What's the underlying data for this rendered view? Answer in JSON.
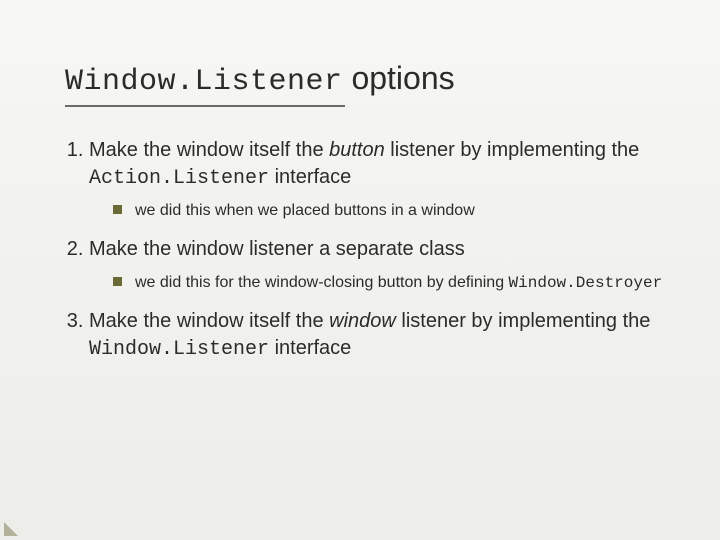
{
  "title": {
    "code": "Window.Listener",
    "rest": " options"
  },
  "items": [
    {
      "pre": " Make the window itself the ",
      "em": "button",
      "mid": " listener by implementing the ",
      "code": "Action.Listener",
      "post": " interface",
      "sub": [
        {
          "text": "we did this when we placed buttons in a window"
        }
      ]
    },
    {
      "pre": " Make the window listener a separate class",
      "em": "",
      "mid": "",
      "code": "",
      "post": "",
      "sub": [
        {
          "text": "we did this for the window-closing button by defining ",
          "code": "Window.Destroyer"
        }
      ]
    },
    {
      "pre": " Make the window itself the ",
      "em": "window",
      "mid": " listener by implementing the ",
      "code": "Window.Listener",
      "post": " interface",
      "sub": []
    }
  ]
}
